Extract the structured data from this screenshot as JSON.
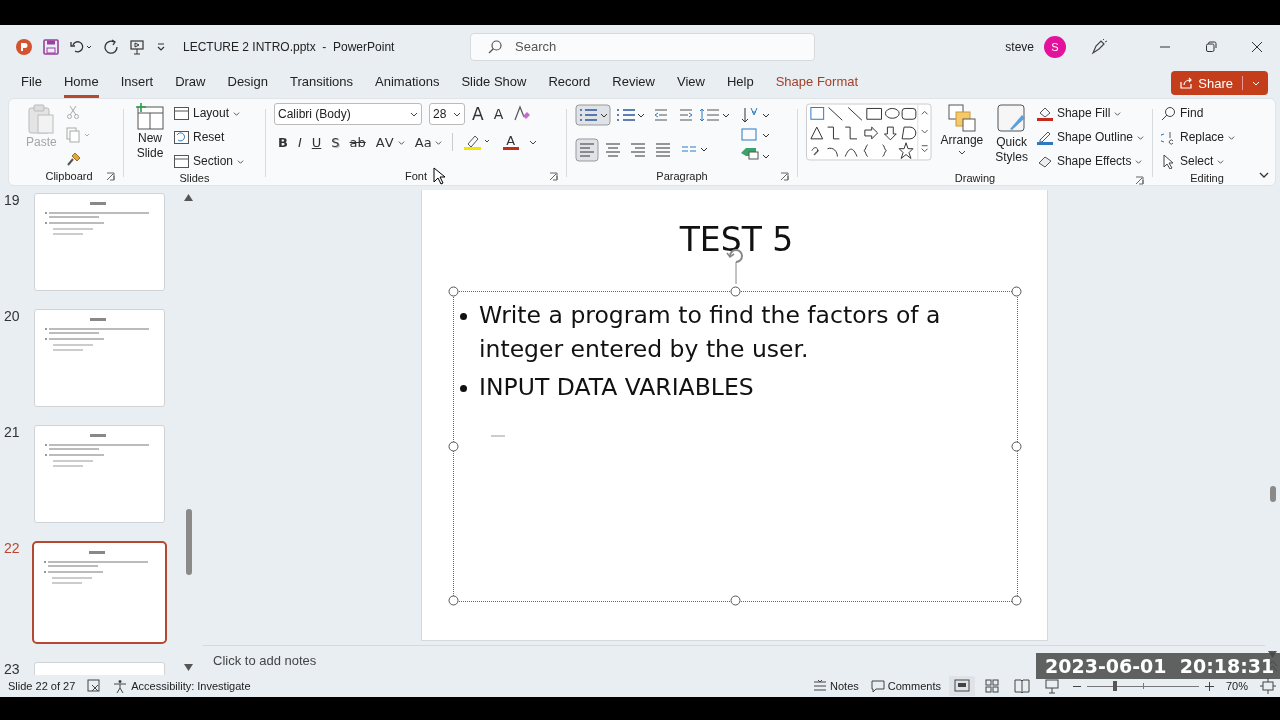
{
  "window": {
    "title": "LECTURE 2 INTRO.pptx  -  PowerPoint"
  },
  "search": {
    "placeholder": "Search"
  },
  "account": {
    "name": "steve",
    "initial": "S"
  },
  "tabs": [
    {
      "label": "File",
      "selected": false,
      "kind": "normal"
    },
    {
      "label": "Home",
      "selected": true,
      "kind": "normal"
    },
    {
      "label": "Insert",
      "selected": false,
      "kind": "normal"
    },
    {
      "label": "Draw",
      "selected": false,
      "kind": "normal"
    },
    {
      "label": "Design",
      "selected": false,
      "kind": "normal"
    },
    {
      "label": "Transitions",
      "selected": false,
      "kind": "normal"
    },
    {
      "label": "Animations",
      "selected": false,
      "kind": "normal"
    },
    {
      "label": "Slide Show",
      "selected": false,
      "kind": "normal"
    },
    {
      "label": "Record",
      "selected": false,
      "kind": "normal"
    },
    {
      "label": "Review",
      "selected": false,
      "kind": "normal"
    },
    {
      "label": "View",
      "selected": false,
      "kind": "normal"
    },
    {
      "label": "Help",
      "selected": false,
      "kind": "normal"
    },
    {
      "label": "Shape Format",
      "selected": false,
      "kind": "contextual"
    }
  ],
  "share": {
    "label": "Share"
  },
  "ribbon": {
    "clipboard": {
      "label": "Clipboard",
      "paste": {
        "label": "Paste",
        "disabled": true
      }
    },
    "slides": {
      "label": "Slides",
      "new_slide": [
        "New",
        "Slide"
      ],
      "items": [
        "Layout",
        "Reset",
        "Section"
      ]
    },
    "font": {
      "label": "Font",
      "name": "Calibri (Body)",
      "size": "28",
      "size_buttons": [
        {
          "label": "A",
          "kind": "grow"
        },
        {
          "label": "A",
          "kind": "shrink"
        }
      ],
      "format_buttons": [
        {
          "label": "B",
          "kind": "bold"
        },
        {
          "label": "I",
          "kind": "italic"
        },
        {
          "label": "U",
          "kind": "underline"
        },
        {
          "label": "S",
          "kind": "shadow"
        },
        {
          "label": "ab",
          "kind": "strike"
        },
        {
          "label": "AV",
          "kind": "spacing"
        },
        {
          "label": "Aa",
          "kind": "case"
        }
      ],
      "font_color": {
        "label": "A"
      }
    },
    "paragraph": {
      "label": "Paragraph"
    },
    "drawing": {
      "label": "Drawing",
      "arrange": "Arrange",
      "quick_styles": [
        "Quick",
        "Styles"
      ],
      "shape_items": [
        "Shape Fill",
        "Shape Outline",
        "Shape Effects"
      ]
    },
    "editing": {
      "label": "Editing",
      "items": [
        "Find",
        "Replace",
        "Select"
      ]
    }
  },
  "thumbnails": [
    {
      "number": "19",
      "kind": "full",
      "selected": false
    },
    {
      "number": "20",
      "kind": "full",
      "selected": false
    },
    {
      "number": "21",
      "kind": "full",
      "selected": false
    },
    {
      "number": "22",
      "kind": "full",
      "selected": true
    },
    {
      "number": "23",
      "kind": "cut",
      "selected": false
    }
  ],
  "slide": {
    "title": "TEST 5",
    "text_box_selected": true,
    "bullets": [
      "Write a program to find the factors of a integer entered by the user.",
      "INPUT DATA VARIABLES"
    ]
  },
  "notes": {
    "placeholder": "Click to add notes"
  },
  "status_bar": {
    "slide_count": "Slide 22 of 27",
    "accessibility": "Accessibility: Investigate",
    "notes": "Notes",
    "comments": "Comments",
    "zoom": {
      "level": 0.25,
      "reading": "70%"
    }
  },
  "timestamp": "2023-06-01  20:18:31"
}
